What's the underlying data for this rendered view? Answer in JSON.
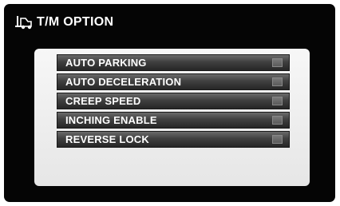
{
  "header": {
    "title": "T/M OPTION",
    "icon": "forklift-icon"
  },
  "options": [
    {
      "label": "AUTO PARKING",
      "checked": false
    },
    {
      "label": "AUTO DECELERATION",
      "checked": false
    },
    {
      "label": "CREEP SPEED",
      "checked": false
    },
    {
      "label": "INCHING ENABLE",
      "checked": false
    },
    {
      "label": "REVERSE LOCK",
      "checked": false
    }
  ],
  "colors": {
    "screen_background": "#050505",
    "panel_background": "#eeeeee",
    "option_background": "#404040",
    "text": "#ffffff"
  }
}
